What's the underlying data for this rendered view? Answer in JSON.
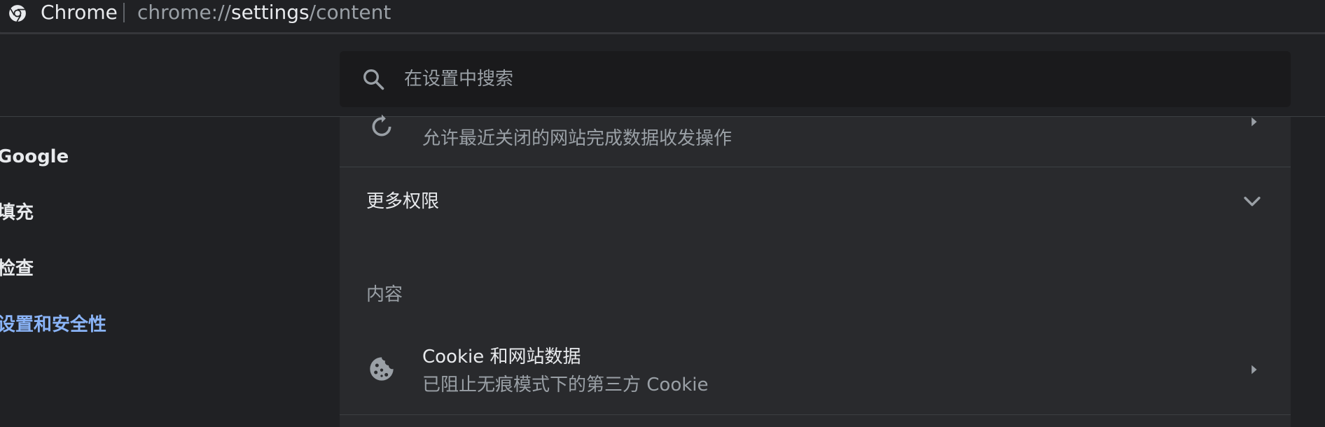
{
  "omnibox": {
    "site_name": "Chrome",
    "url_scheme": "chrome://",
    "url_host": "settings",
    "url_path": "/content"
  },
  "search": {
    "placeholder": "在设置中搜索"
  },
  "sidebar": {
    "items": [
      {
        "label": "Google",
        "active": false
      },
      {
        "label": "填充",
        "active": false
      },
      {
        "label": "检查",
        "active": false
      },
      {
        "label": "设置和安全性",
        "active": true
      }
    ]
  },
  "content": {
    "background_sync_sub": "允许最近关闭的网站完成数据收发操作",
    "more_permissions_label": "更多权限",
    "content_section_title": "内容",
    "cookie_row": {
      "title": "Cookie 和网站数据",
      "sub": "已阻止无痕模式下的第三方 Cookie"
    }
  },
  "colors": {
    "background": "#202124",
    "card": "#292a2d",
    "accent": "#8ab4f8",
    "text_primary": "#e8eaed",
    "text_secondary": "#9aa0a6"
  },
  "icons": {
    "browser": "chrome-icon",
    "search": "search-icon",
    "sync": "sync-icon",
    "cookie": "cookie-icon",
    "arrow": "arrow-right-icon",
    "expand": "chevron-down-icon"
  }
}
